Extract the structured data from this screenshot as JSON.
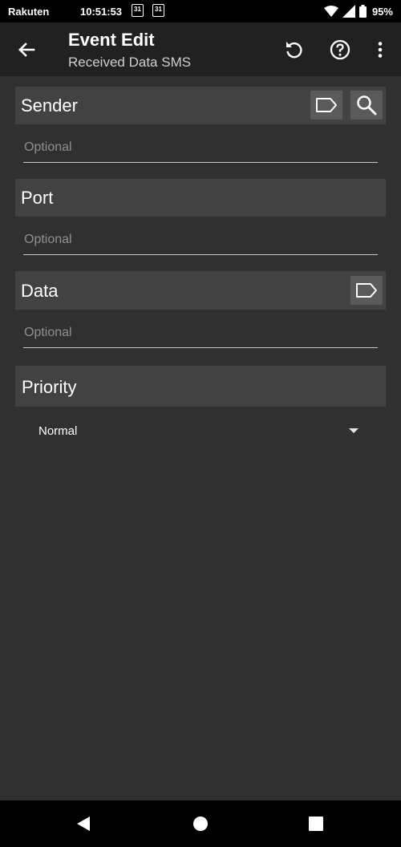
{
  "status_bar": {
    "carrier": "Rakuten",
    "time": "10:51:53",
    "calendar_1": "31",
    "calendar_2": "31",
    "battery": "95%"
  },
  "app_bar": {
    "title": "Event Edit",
    "subtitle": "Received Data SMS",
    "back_icon": "arrow-left-icon",
    "reset_icon": "undo-icon",
    "help_icon": "help-circle-icon",
    "more_icon": "more-vert-icon"
  },
  "sections": {
    "sender": {
      "label": "Sender",
      "placeholder": "Optional"
    },
    "port": {
      "label": "Port",
      "placeholder": "Optional"
    },
    "data": {
      "label": "Data",
      "placeholder": "Optional"
    },
    "priority": {
      "label": "Priority",
      "selected": "Normal"
    }
  },
  "nav_bar": {
    "back_icon": "triangle-back-icon",
    "home_icon": "circle-home-icon",
    "recents_icon": "square-recents-icon"
  }
}
